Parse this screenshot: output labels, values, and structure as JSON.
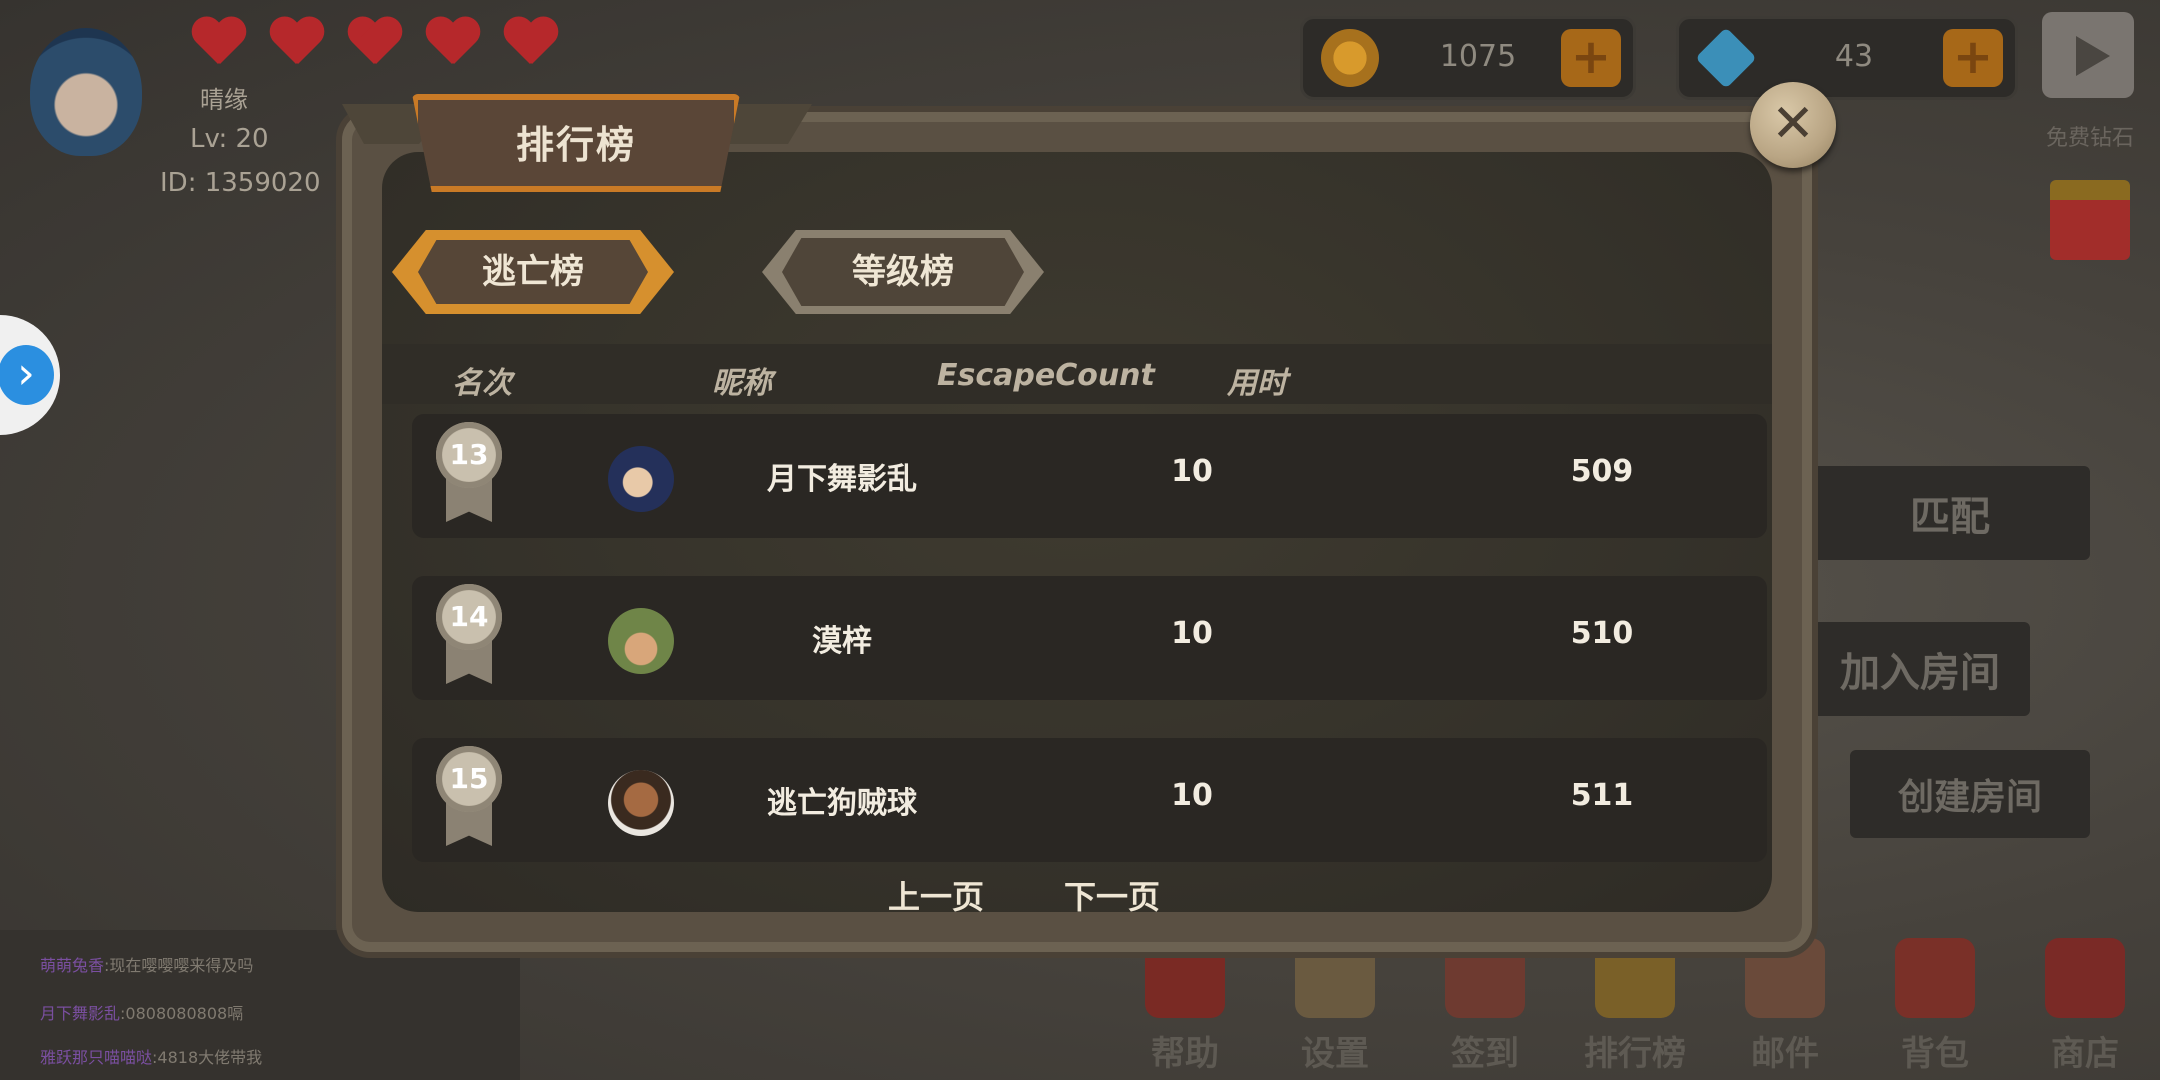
{
  "player": {
    "name": "晴缘",
    "level": "Lv: 20",
    "id": "ID: 1359020"
  },
  "currency": {
    "coins": "1075",
    "gems": "43"
  },
  "free_gem_label": "免费钻石",
  "right_menu": {
    "match": "匹配",
    "join_room": "加入房间",
    "create_room": "创建房间"
  },
  "chat": [
    {
      "nick": "萌萌兔香",
      "text": "现在嘤嘤嘤来得及吗"
    },
    {
      "nick": "月下舞影乱",
      "text": "0808080808嗝"
    },
    {
      "nick": "雅跃那只喵喵哒",
      "text": "4818大佬带我"
    }
  ],
  "bottom_nav": [
    "帮助",
    "设置",
    "签到",
    "排行榜",
    "邮件",
    "背包",
    "商店"
  ],
  "panel": {
    "title": "排行榜",
    "close_label": "✕",
    "tabs": {
      "escape": "逃亡榜",
      "level": "等级榜"
    },
    "headers": {
      "rank": "名次",
      "nickname": "昵称",
      "escape_count": "EscapeCount",
      "time": "用时"
    },
    "rows": [
      {
        "rank": "13",
        "nickname": "月下舞影乱",
        "escape_count": "10",
        "time": "509"
      },
      {
        "rank": "14",
        "nickname": "漠梓",
        "escape_count": "10",
        "time": "510"
      },
      {
        "rank": "15",
        "nickname": "逃亡狗贼球",
        "escape_count": "10",
        "time": "511"
      }
    ],
    "prev_page": "上一页",
    "next_page": "下一页"
  }
}
